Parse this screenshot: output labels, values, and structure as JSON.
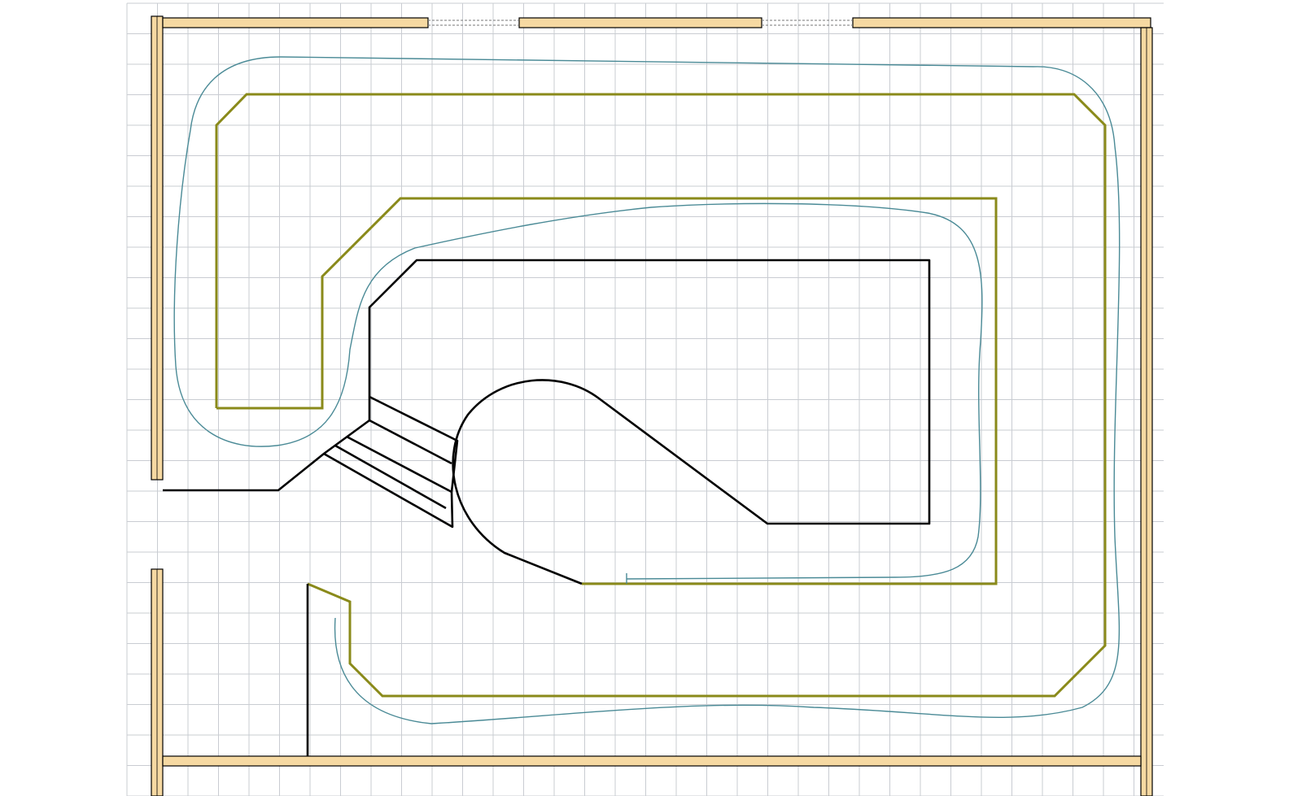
{
  "drawing": {
    "kind": "track-plan-layout",
    "grid": true,
    "colors": {
      "background": "#ffffff",
      "grid_line": "#c9ccd2",
      "wall_fill": "#f6d9a2",
      "wall_edge": "#000000",
      "window_dash": "#777777",
      "benchwork": "#8a8a1a",
      "track": "#4a8a96",
      "structure": "#000000"
    }
  }
}
